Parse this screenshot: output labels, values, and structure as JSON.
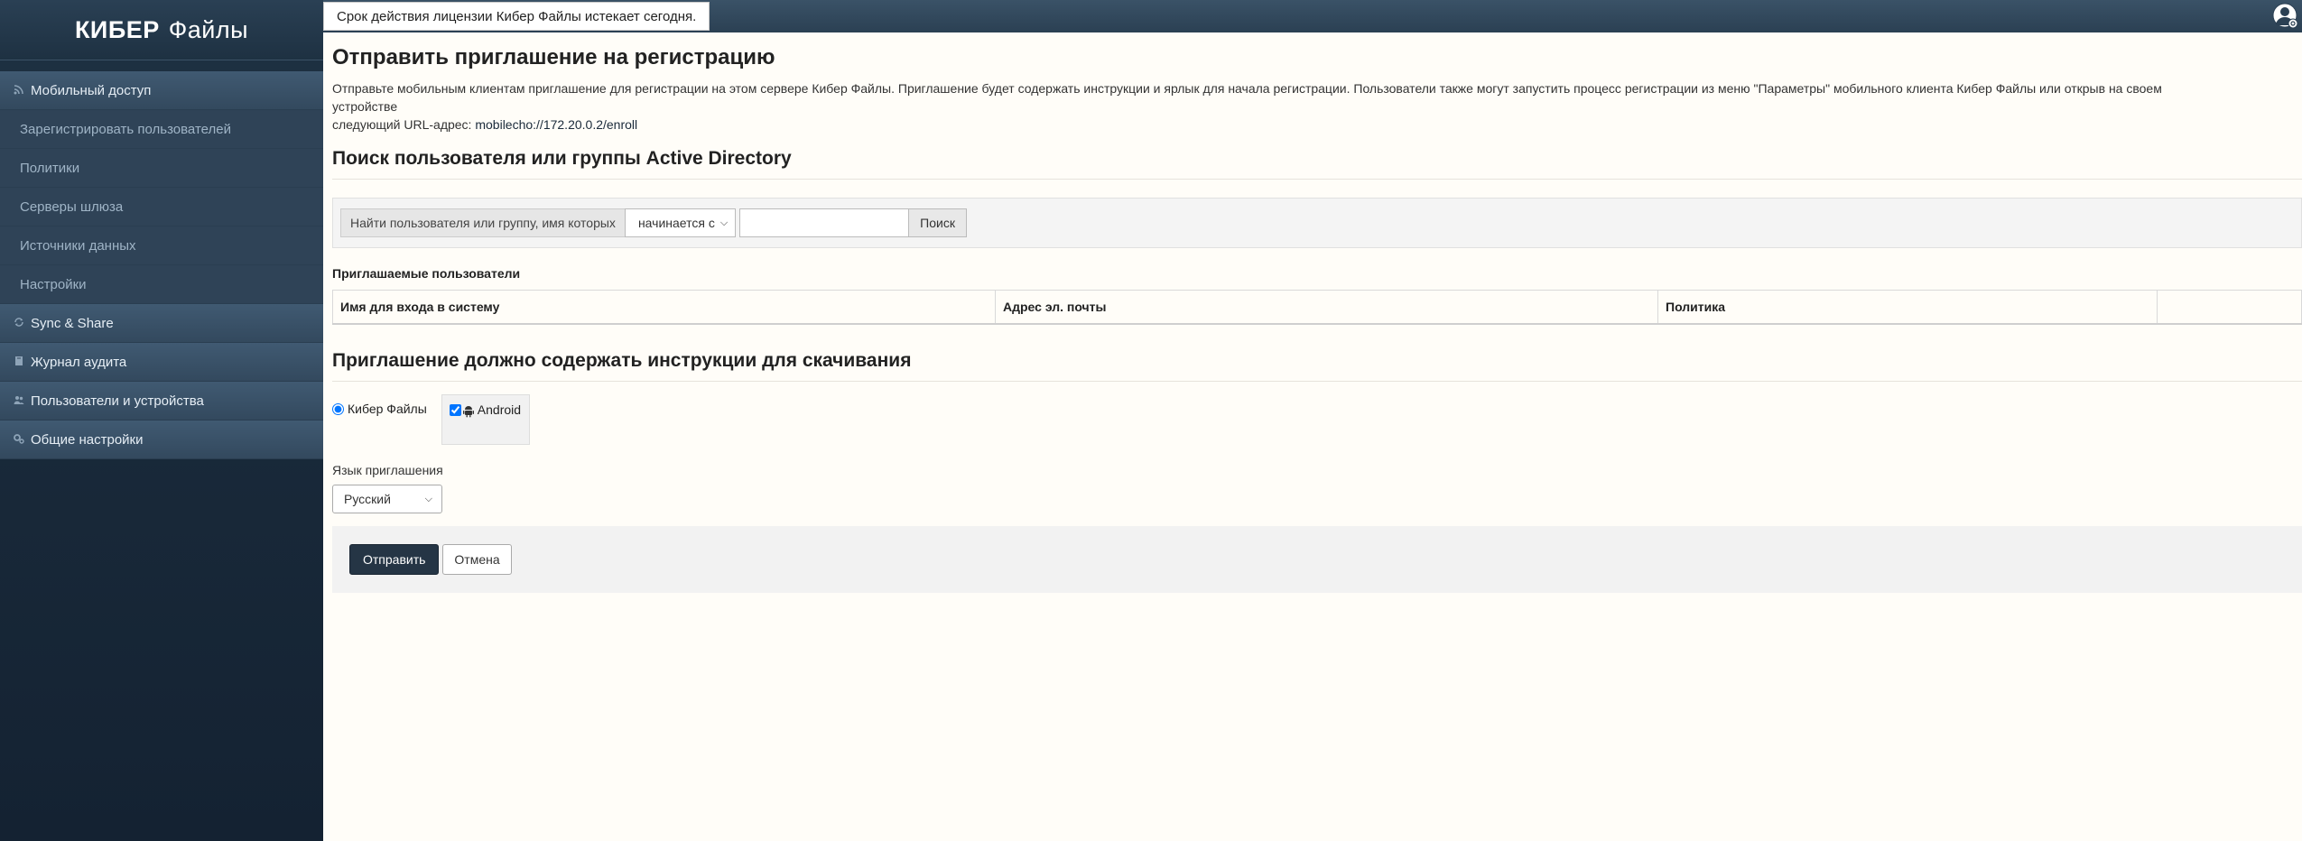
{
  "brand": {
    "name": "КИБЕР",
    "product": "Файлы"
  },
  "notice": {
    "text": "Срок действия лицензии Кибер Файлы истекает сегодня."
  },
  "sidebar": {
    "sections": [
      {
        "label": "Мобильный доступ",
        "icon": "rss-icon"
      },
      {
        "label": "Sync & Share",
        "icon": "sync-icon"
      },
      {
        "label": "Журнал аудита",
        "icon": "book-icon"
      },
      {
        "label": "Пользователи и устройства",
        "icon": "users-icon"
      },
      {
        "label": "Общие настройки",
        "icon": "gears-icon"
      }
    ],
    "subitems": [
      "Зарегистрировать пользователей",
      "Политики",
      "Серверы шлюза",
      "Источники данных",
      "Настройки"
    ]
  },
  "page": {
    "title": "Отправить приглашение на регистрацию",
    "description_line1": "Отправьте мобильным клиентам приглашение для регистрации на этом сервере Кибер Файлы. Приглашение будет содержать инструкции и ярлык для начала регистрации. Пользователи также могут запустить процесс регистрации из меню \"Параметры\" мобильного клиента Кибер Файлы или открыв на своем устройстве",
    "description_line2": "следующий URL-адрес: ",
    "enroll_url": "mobilecho://172.20.0.2/enroll"
  },
  "search": {
    "section_title": "Поиск пользователя или группы Active Directory",
    "label": "Найти пользователя или группу, имя которых",
    "match_mode": "начинается с",
    "input_value": "",
    "button_label": "Поиск"
  },
  "invited": {
    "title": "Приглашаемые пользователи",
    "columns": [
      "Имя для входа в систему",
      "Адрес эл. почты",
      "Политика",
      ""
    ]
  },
  "instructions": {
    "section_title": "Приглашение должно содержать инструкции для скачивания",
    "radio_label": "Кибер Файлы",
    "platform_label": "Android",
    "language_label": "Язык приглашения",
    "language_value": "Русский"
  },
  "actions": {
    "submit_label": "Отправить",
    "cancel_label": "Отмена"
  },
  "colors": {
    "sidebar_bg": "#142232",
    "primary_button": "#253545",
    "page_bg": "#fffdf8"
  }
}
